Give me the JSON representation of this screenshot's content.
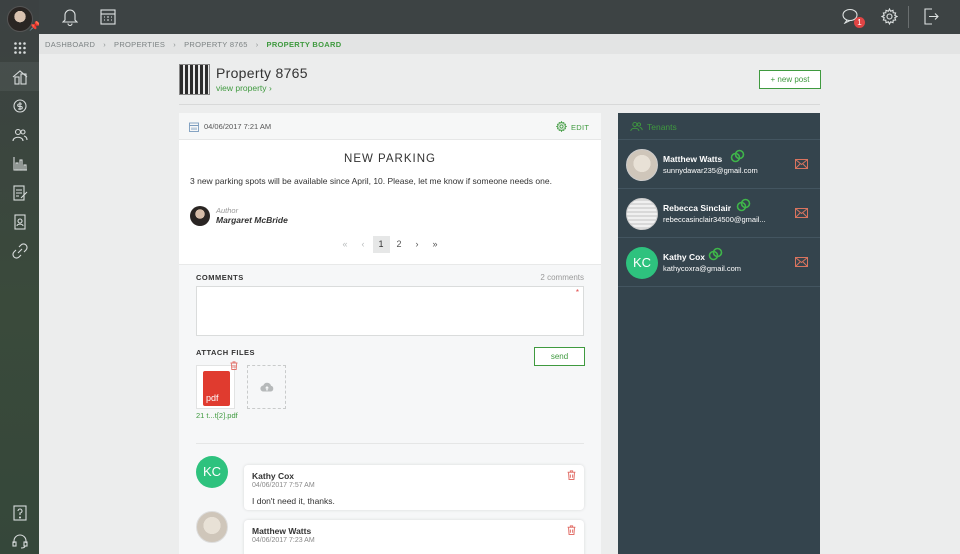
{
  "colors": {
    "accent": "#3f9a3f",
    "sidebar": "#3c4142",
    "tenants_bg": "#34444d",
    "badge": "#e04545",
    "avatar_green": "#2ec27e"
  },
  "sidebar": {
    "items": [
      {
        "icon": "grid-icon"
      },
      {
        "icon": "properties-icon"
      },
      {
        "icon": "finance-icon"
      },
      {
        "icon": "people-icon"
      },
      {
        "icon": "reports-chart-icon"
      },
      {
        "icon": "document-edit-icon"
      },
      {
        "icon": "contact-document-icon"
      },
      {
        "icon": "link-icon"
      }
    ],
    "bottom": [
      {
        "icon": "help-icon"
      },
      {
        "icon": "headset-icon"
      }
    ]
  },
  "topbar": {
    "notification_count": "1",
    "icons": [
      "bell-icon",
      "calendar-icon",
      "chat-icon",
      "gear-icon",
      "logout-icon"
    ]
  },
  "breadcrumb": [
    "DASHBOARD",
    "PROPERTIES",
    "PROPERTY 8765",
    "PROPERTY BOARD"
  ],
  "property": {
    "title": "Property 8765",
    "link_label": "view property",
    "new_post_label": "+ new post"
  },
  "post": {
    "date": "04/06/2017 7:21 AM",
    "edit_label": "EDIT",
    "title": "NEW PARKING",
    "body": "3 new parking spots will be available since April, 10. Please, let me know if someone needs one.",
    "author_label": "Author",
    "author_name": "Margaret McBride",
    "pagination": [
      "«",
      "‹",
      "1",
      "2",
      "›",
      "»"
    ]
  },
  "comments": {
    "label": "COMMENTS",
    "count_label": "2 comments",
    "required_mark": "*",
    "attach_label": "ATTACH FILES",
    "send_label": "send",
    "file_type": "pdf",
    "file_name": "21 t...t[2].pdf",
    "items": [
      {
        "initials": "KC",
        "name": "Kathy Cox",
        "date": "04/06/2017 7:57 AM",
        "text": "I don't need it, thanks."
      },
      {
        "initials": "",
        "name": "Matthew Watts",
        "date": "04/06/2017 7:23 AM",
        "text": ""
      }
    ]
  },
  "tenants": {
    "title": "Tenants",
    "items": [
      {
        "initials": "",
        "name": "Matthew Watts",
        "email": "sunnydawar235@gmail.com"
      },
      {
        "initials": "",
        "name": "Rebecca Sinclair",
        "email": "rebeccasinclair34500@gmail..."
      },
      {
        "initials": "KC",
        "name": "Kathy Cox",
        "email": "kathycoxra@gmail.com"
      }
    ]
  }
}
